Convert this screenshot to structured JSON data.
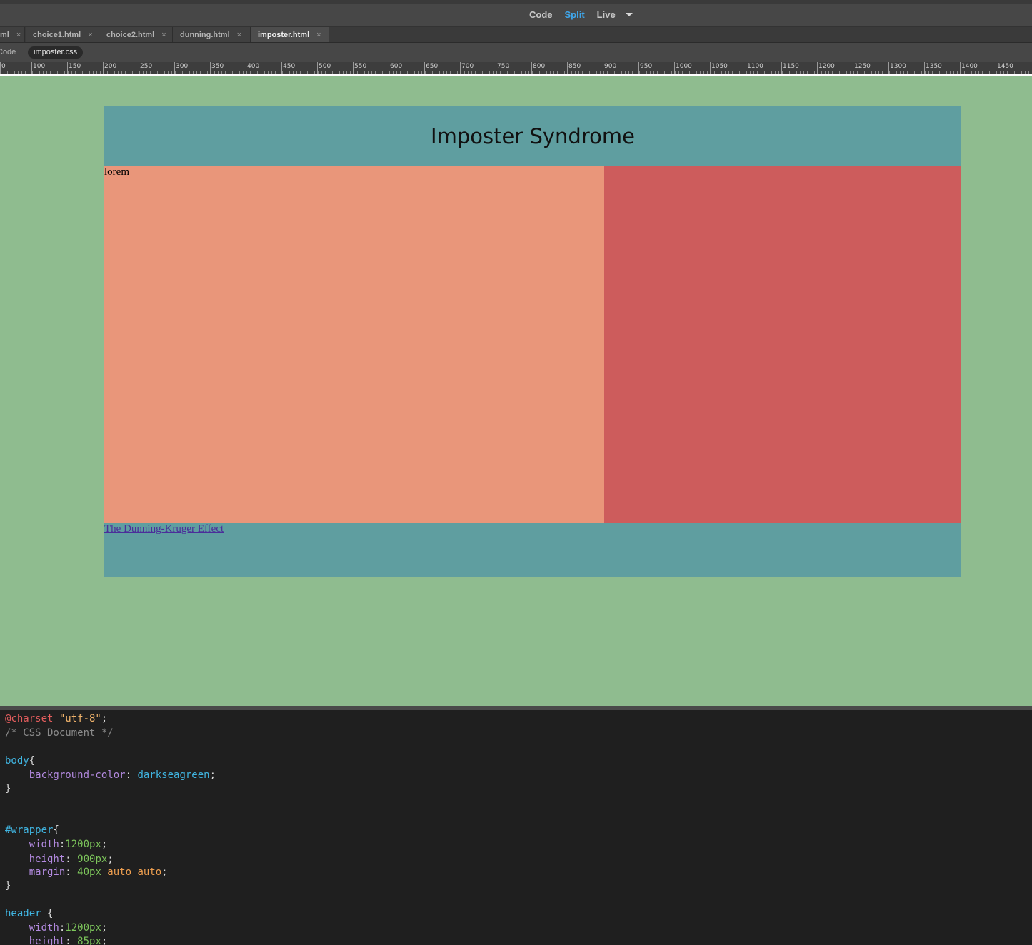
{
  "toolbar": {
    "views": [
      {
        "label": "Code",
        "active": false
      },
      {
        "label": "Split",
        "active": true
      },
      {
        "label": "Live",
        "active": false
      }
    ],
    "accent_color": "#3fa6ea"
  },
  "tabs": [
    {
      "label": "ml",
      "active": false
    },
    {
      "label": "choice1.html",
      "active": false
    },
    {
      "label": "choice2.html",
      "active": false
    },
    {
      "label": "dunning.html",
      "active": false
    },
    {
      "label": "imposter.html",
      "active": true
    }
  ],
  "tab_close_glyph": "×",
  "related_files": {
    "source_code_label": "Code",
    "files": [
      "imposter.css"
    ]
  },
  "ruler": {
    "labels": [
      "0",
      "100",
      "150",
      "200",
      "250",
      "300",
      "350",
      "400",
      "450",
      "500",
      "550",
      "600",
      "650",
      "700",
      "750",
      "800",
      "850",
      "900",
      "950",
      "1000",
      "1050",
      "1100",
      "1150",
      "1200",
      "1250",
      "1300",
      "1350",
      "1400",
      "1450"
    ]
  },
  "live_view": {
    "body_color": "#8fbc8f",
    "header_color": "#5f9ea0",
    "main_color": "#e9967a",
    "side_color": "#cd5c5c",
    "footer_color": "#5f9ea0",
    "title": "Imposter Syndrome",
    "main_text": "lorem",
    "footer_link": "The Dunning-Kruger Effect"
  },
  "code_lines": [
    [
      {
        "t": "@charset ",
        "c": "at"
      },
      {
        "t": "\"utf-8\"",
        "c": "str"
      },
      {
        "t": ";",
        "c": "punc"
      }
    ],
    [
      {
        "t": "/* CSS Document */",
        "c": "cmt"
      }
    ],
    [],
    [
      {
        "t": "body",
        "c": "sel"
      },
      {
        "t": "{",
        "c": "punc"
      }
    ],
    [
      {
        "t": "    background-color",
        "c": "prop"
      },
      {
        "t": ": ",
        "c": "punc"
      },
      {
        "t": "darkseagreen",
        "c": "val"
      },
      {
        "t": ";",
        "c": "punc"
      }
    ],
    [
      {
        "t": "}",
        "c": "punc"
      }
    ],
    [],
    [],
    [
      {
        "t": "#wrapper",
        "c": "sel"
      },
      {
        "t": "{",
        "c": "punc"
      }
    ],
    [
      {
        "t": "    width",
        "c": "prop"
      },
      {
        "t": ":",
        "c": "punc"
      },
      {
        "t": "1200px",
        "c": "num"
      },
      {
        "t": ";",
        "c": "punc"
      }
    ],
    [
      {
        "t": "    height",
        "c": "prop"
      },
      {
        "t": ": ",
        "c": "punc"
      },
      {
        "t": "900px",
        "c": "num"
      },
      {
        "t": ";",
        "c": "punc"
      },
      {
        "t": "",
        "c": "cursor"
      }
    ],
    [
      {
        "t": "    margin",
        "c": "prop"
      },
      {
        "t": ": ",
        "c": "punc"
      },
      {
        "t": "40px",
        "c": "num"
      },
      {
        "t": " auto auto",
        "c": "kw"
      },
      {
        "t": ";",
        "c": "punc"
      }
    ],
    [
      {
        "t": "}",
        "c": "punc"
      }
    ],
    [],
    [
      {
        "t": "header",
        "c": "sel"
      },
      {
        "t": " {",
        "c": "punc"
      }
    ],
    [
      {
        "t": "    width",
        "c": "prop"
      },
      {
        "t": ":",
        "c": "punc"
      },
      {
        "t": "1200px",
        "c": "num"
      },
      {
        "t": ";",
        "c": "punc"
      }
    ],
    [
      {
        "t": "    height",
        "c": "prop"
      },
      {
        "t": ": ",
        "c": "punc"
      },
      {
        "t": "85px",
        "c": "num"
      },
      {
        "t": ";",
        "c": "punc"
      }
    ]
  ]
}
